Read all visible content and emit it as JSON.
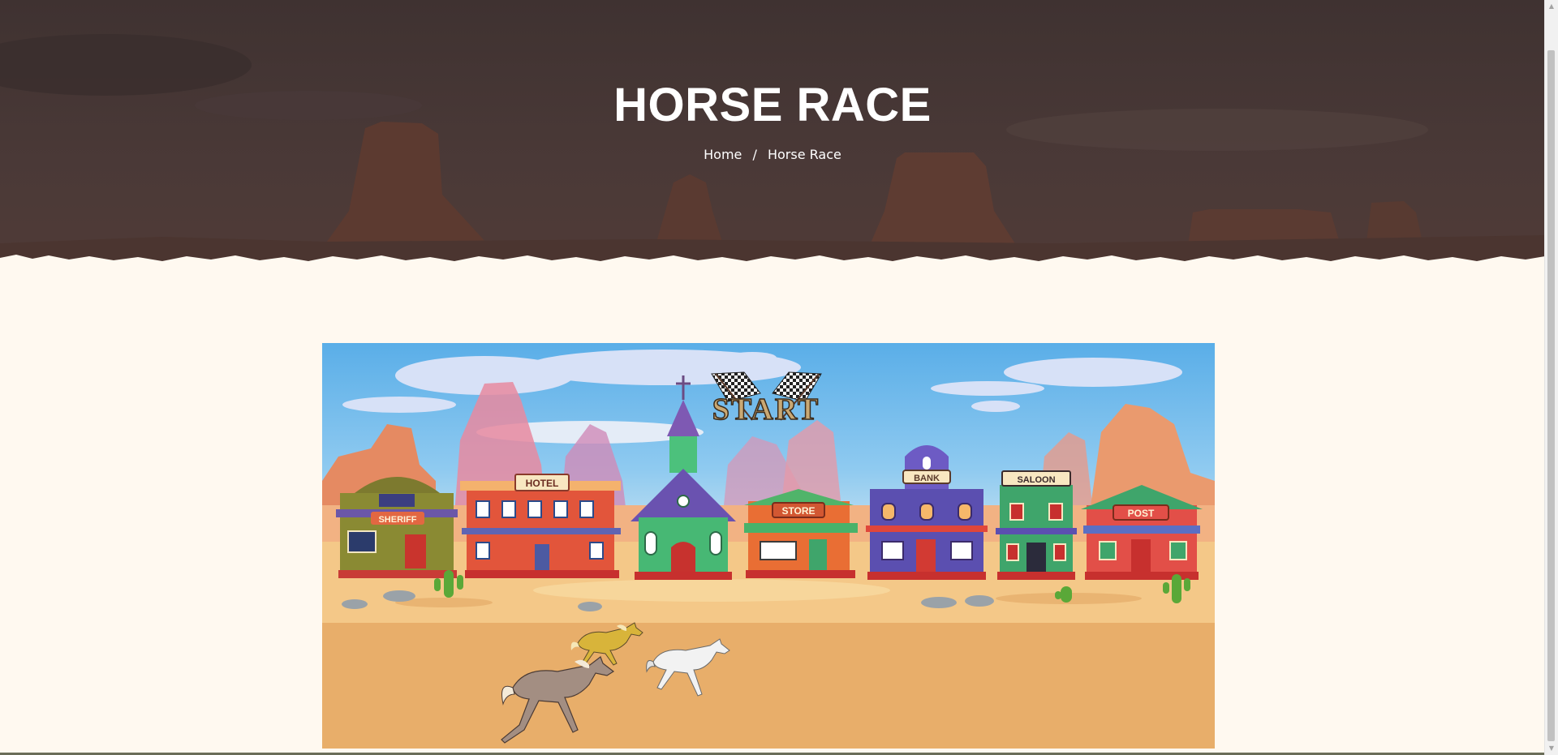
{
  "hero": {
    "title": "HORSE RACE",
    "breadcrumb": {
      "home": "Home",
      "separator": "/",
      "current": "Horse Race"
    }
  },
  "game": {
    "start_text": "START",
    "buildings": [
      "SHERIFF",
      "HOTEL",
      "STORE",
      "BANK",
      "SALOON",
      "POST"
    ],
    "horses": [
      {
        "name": "yellow-horse",
        "color": "#d8b43a"
      },
      {
        "name": "white-horse",
        "color": "#f2f2f2"
      },
      {
        "name": "brown-horse",
        "color": "#a38e82"
      }
    ]
  },
  "colors": {
    "page_background": "#fff9f0",
    "hero_overlay": "#3d302e",
    "sky": "#6ab6ea",
    "ground": "#e8ae6a"
  },
  "icons": {
    "scroll_up": "scroll-up-arrow-icon",
    "scroll_down": "scroll-down-arrow-icon",
    "checkered_flags": "checkered-flags-icon"
  }
}
